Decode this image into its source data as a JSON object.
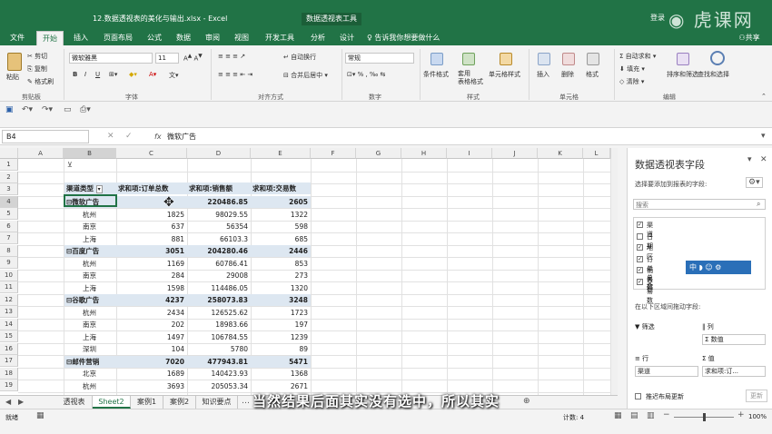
{
  "window": {
    "title": "12.数据透视表的美化与输出.xlsx - Excel",
    "context_tab": "数据透视表工具",
    "user": "登录"
  },
  "watermark": "虎课网",
  "tabs": [
    "文件",
    "开始",
    "插入",
    "页面布局",
    "公式",
    "数据",
    "审阅",
    "视图",
    "开发工具",
    "分析",
    "设计",
    "告诉我你想要做什么",
    "共享"
  ],
  "ribbon": {
    "clipboard": {
      "paste": "粘贴",
      "cut": "剪切",
      "copy": "复制",
      "format_painter": "格式刷",
      "group": "剪贴板"
    },
    "font": {
      "name": "微软雅黑",
      "size": "11",
      "bold": "B",
      "italic": "I",
      "underline": "U",
      "group": "字体"
    },
    "alignment": {
      "wrap": "自动换行",
      "merge": "合并后居中",
      "group": "对齐方式"
    },
    "number": {
      "format": "常规",
      "group": "数字"
    },
    "styles": {
      "conditional": "条件格式",
      "table": "套用\n表格格式",
      "cell": "单元格样式",
      "group": "样式"
    },
    "cells": {
      "insert": "插入",
      "delete": "删除",
      "format": "格式",
      "group": "单元格"
    },
    "editing": {
      "autosum": "自动求和",
      "fill": "填充",
      "clear": "清除",
      "sort": "排序和筛选",
      "find": "查找和选择",
      "group": "编辑"
    }
  },
  "formula_bar": {
    "name_box": "B4",
    "fx": "fx",
    "value": "微软广告"
  },
  "columns": [
    "A",
    "B",
    "C",
    "D",
    "E",
    "F",
    "G",
    "H",
    "I",
    "J",
    "K",
    "L"
  ],
  "rows": [
    "1",
    "2",
    "3",
    "4",
    "5",
    "6",
    "7",
    "8",
    "9",
    "10",
    "11",
    "12",
    "13",
    "14",
    "15",
    "16",
    "17",
    "18",
    "19"
  ],
  "pivot": {
    "headers": [
      "渠道类型",
      "求和项:订单总数",
      "求和项:销售额",
      "求和项:交易数"
    ],
    "data": [
      {
        "label": "⊟微软广告",
        "c": "",
        "d": "220486.85",
        "e": "2605",
        "group": true
      },
      {
        "label": "杭州",
        "c": "1825",
        "d": "98029.55",
        "e": "1322"
      },
      {
        "label": "南京",
        "c": "637",
        "d": "56354",
        "e": "598"
      },
      {
        "label": "上海",
        "c": "881",
        "d": "66103.3",
        "e": "685"
      },
      {
        "label": "⊟百度广告",
        "c": "3051",
        "d": "204280.46",
        "e": "2446",
        "group": true
      },
      {
        "label": "杭州",
        "c": "1169",
        "d": "60786.41",
        "e": "853"
      },
      {
        "label": "南京",
        "c": "284",
        "d": "29008",
        "e": "273"
      },
      {
        "label": "上海",
        "c": "1598",
        "d": "114486.05",
        "e": "1320"
      },
      {
        "label": "⊟谷歌广告",
        "c": "4237",
        "d": "258073.83",
        "e": "3248",
        "group": true
      },
      {
        "label": "杭州",
        "c": "2434",
        "d": "126525.62",
        "e": "1723"
      },
      {
        "label": "南京",
        "c": "202",
        "d": "18983.66",
        "e": "197"
      },
      {
        "label": "上海",
        "c": "1497",
        "d": "106784.55",
        "e": "1239"
      },
      {
        "label": "深圳",
        "c": "104",
        "d": "5780",
        "e": "89"
      },
      {
        "label": "⊟邮件营销",
        "c": "7020",
        "d": "477943.81",
        "e": "5471",
        "group": true
      },
      {
        "label": "北京",
        "c": "1689",
        "d": "140423.93",
        "e": "1368"
      },
      {
        "label": "杭州",
        "c": "3693",
        "d": "205053.34",
        "e": "2671"
      }
    ]
  },
  "sheets": [
    "透视表",
    "Sheet2",
    "案例1",
    "案例2",
    "知识要点"
  ],
  "status": {
    "ready": "就绪",
    "count": "计数: 4",
    "zoom": "100%"
  },
  "field_pane": {
    "title": "数据透视表字段",
    "subtitle": "选择要添加到报表的字段:",
    "search": "搜索",
    "fields": [
      {
        "name": "渠道",
        "checked": true
      },
      {
        "name": "日期",
        "checked": false
      },
      {
        "name": "地区",
        "checked": true
      },
      {
        "name": "订单总数",
        "checked": true
      },
      {
        "name": "销售额",
        "checked": true
      },
      {
        "name": "交易数",
        "checked": true
      }
    ],
    "drag_label": "在以下区域间拖动字段:",
    "filter": "筛选",
    "columns": "列",
    "columns_value": "Σ 数值",
    "rows": "行",
    "rows_value": "渠道",
    "values": "值",
    "values_value": "求和项:订...",
    "defer": "推迟布局更新",
    "update": "更新",
    "ime": "中"
  },
  "subtitle": "当然结果后面其实没有选中，所以其实"
}
